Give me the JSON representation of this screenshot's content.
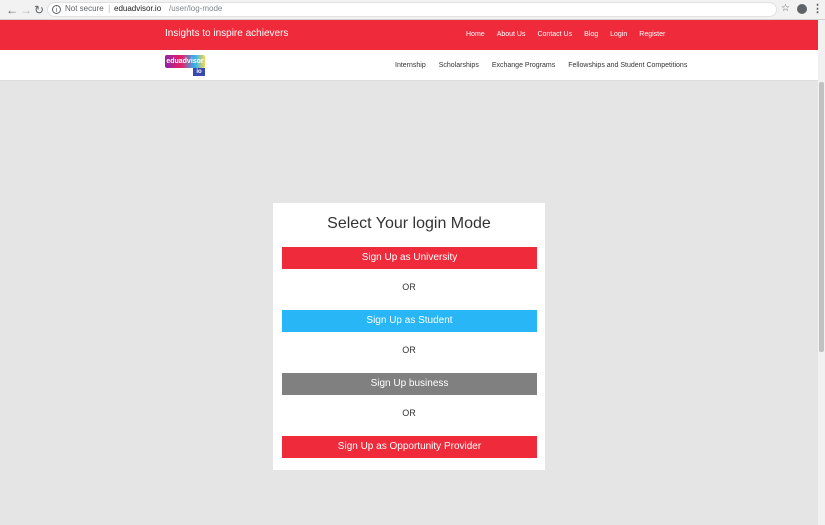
{
  "browser": {
    "back_icon": "arrow-left-icon",
    "forward_icon": "arrow-right-icon",
    "reload_icon": "reload-icon",
    "security_label": "Not secure",
    "url_domain": "eduadvisor.io",
    "url_path": "/user/log-mode"
  },
  "topbar": {
    "tagline": "Insights to inspire achievers",
    "links": [
      "Home",
      "About Us",
      "Contact Us",
      "Blog",
      "Login",
      "Register"
    ]
  },
  "navbar": {
    "logo_main": "eduadvisor",
    "logo_sub": "io",
    "links": [
      "Internship",
      "Scholarships",
      "Exchange Programs",
      "Fellowships and Student Competitions"
    ]
  },
  "login": {
    "title": "Select Your login Mode",
    "buttons": [
      {
        "label": "Sign Up as University",
        "color": "#ef2a3a"
      },
      {
        "label": "Sign Up as Student",
        "color": "#29b6f6"
      },
      {
        "label": "Sign Up business",
        "color": "#808080"
      },
      {
        "label": "Sign Up as Opportunity Provider",
        "color": "#ef2a3a"
      }
    ],
    "separator": "OR"
  },
  "colors": {
    "brand_red": "#ef2a3a",
    "student_blue": "#29b6f6",
    "business_gray": "#808080",
    "page_bg": "#e5e5e5"
  }
}
